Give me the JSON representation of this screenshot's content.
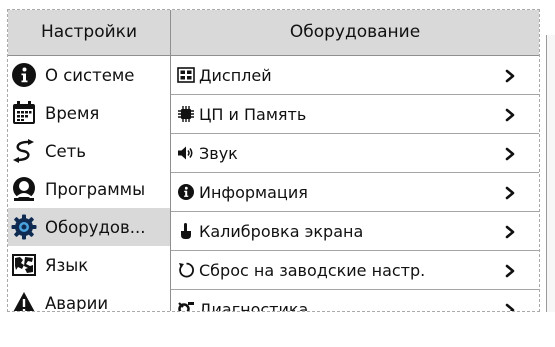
{
  "header": {
    "left_title": "Настройки",
    "right_title": "Оборудование"
  },
  "sidebar": {
    "items": [
      {
        "label": "О системе",
        "icon": "info-icon"
      },
      {
        "label": "Время",
        "icon": "calendar-icon"
      },
      {
        "label": "Сеть",
        "icon": "network-icon"
      },
      {
        "label": "Программы",
        "icon": "programs-icon"
      },
      {
        "label": "Оборудов...",
        "icon": "gear-icon",
        "selected": true
      },
      {
        "label": "Язык",
        "icon": "language-map-icon"
      },
      {
        "label": "Аварии",
        "icon": "warning-icon"
      }
    ]
  },
  "main": {
    "items": [
      {
        "label": "Дисплей",
        "icon": "display-icon"
      },
      {
        "label": "ЦП и Память",
        "icon": "chip-icon"
      },
      {
        "label": "Звук",
        "icon": "speaker-icon"
      },
      {
        "label": "Информация",
        "icon": "info-icon"
      },
      {
        "label": "Калибровка экрана",
        "icon": "touch-hand-icon"
      },
      {
        "label": "Сброс на заводские настр.",
        "icon": "reset-icon"
      },
      {
        "label": "Диагностика",
        "icon": "diagnostics-icon"
      }
    ]
  },
  "colors": {
    "header_bg": "#d9d9d9",
    "selected_bg": "#d9d9d9",
    "separator": "#8f8f8f"
  }
}
